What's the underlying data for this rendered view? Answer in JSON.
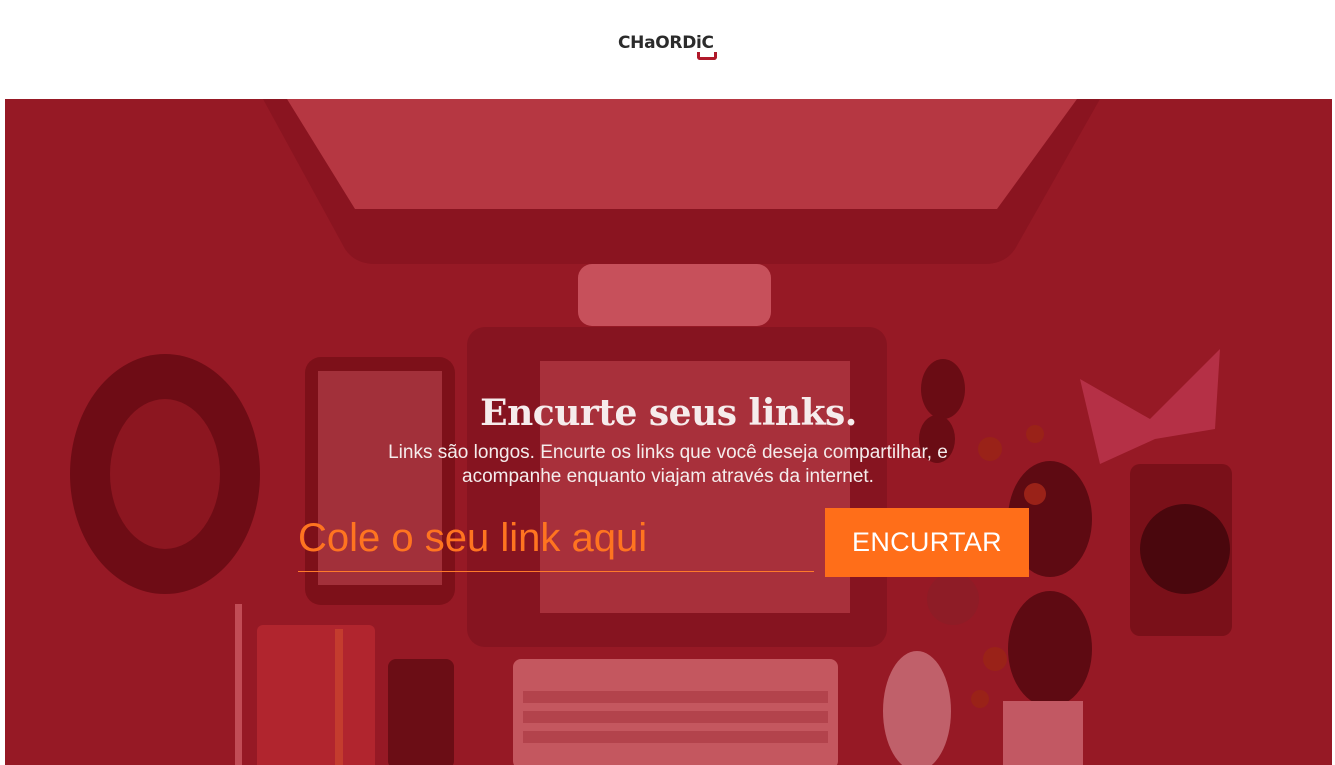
{
  "header": {
    "logo_text": "CHaORDiC"
  },
  "hero": {
    "title": "Encurte seus links.",
    "subtitle": "Links são longos. Encurte os links que você deseja compartilhar, e acompanhe enquanto viajam através da internet.",
    "input_placeholder": "Cole o seu link aqui",
    "button_label": "ENCURTAR"
  },
  "colors": {
    "brand_red": "#b0192a",
    "overlay_red": "#961925",
    "accent_orange": "#ff6e19",
    "text_light": "#f6ecec"
  },
  "icons": [
    "logo-mark-icon"
  ]
}
